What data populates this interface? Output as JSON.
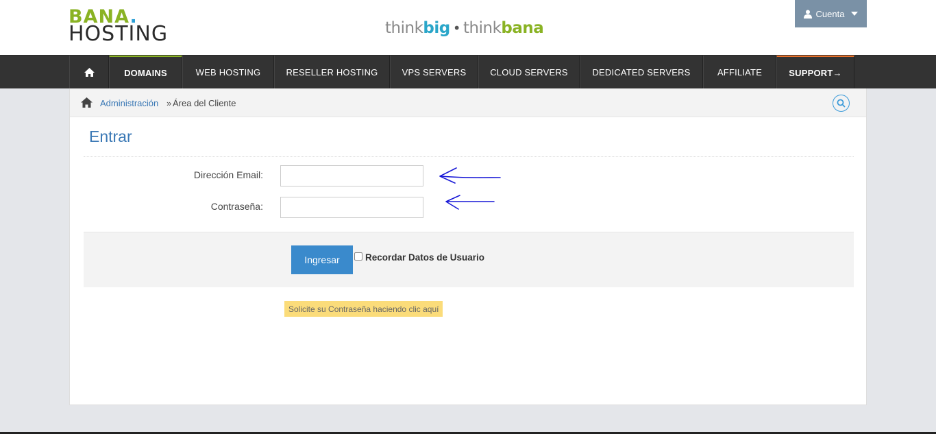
{
  "header": {
    "logo": {
      "line1": "BANA",
      "dot": ".",
      "line2": "HOSTING"
    },
    "tagline": {
      "think1": "think",
      "big": "big",
      "separator": "•",
      "think2": "think",
      "bana": "bana"
    },
    "account_label": "Cuenta"
  },
  "nav": {
    "items": [
      {
        "label": "DOMAINS"
      },
      {
        "label": "WEB HOSTING"
      },
      {
        "label": "RESELLER HOSTING"
      },
      {
        "label": "VPS SERVERS"
      },
      {
        "label": "CLOUD SERVERS"
      },
      {
        "label": "DEDICATED SERVERS"
      },
      {
        "label": "AFFILIATE"
      },
      {
        "label": "SUPPORT→"
      }
    ]
  },
  "breadcrumb": {
    "link": "Administración",
    "separator": "»",
    "current": "Área del Cliente"
  },
  "login": {
    "title": "Entrar",
    "email_label": "Dirección Email:",
    "email_value": "",
    "password_label": "Contraseña:",
    "password_value": "",
    "submit_label": "Ingresar",
    "remember_label": "Recordar Datos de Usuario",
    "remember_checked": false,
    "reset_link": "Solicite su Contraseña haciendo clic aquí"
  },
  "colors": {
    "brand_green": "#8ab324",
    "brand_blue": "#2aa6c9",
    "nav_bg": "#333333",
    "link_blue": "#3a78b5",
    "button_blue": "#3a8acc",
    "annotation_arrow": "#1616d6",
    "reset_highlight": "#fbdc7a"
  },
  "icons": [
    "home-icon",
    "user-icon",
    "caret-down-icon",
    "search-icon",
    "arrow-annotation"
  ]
}
